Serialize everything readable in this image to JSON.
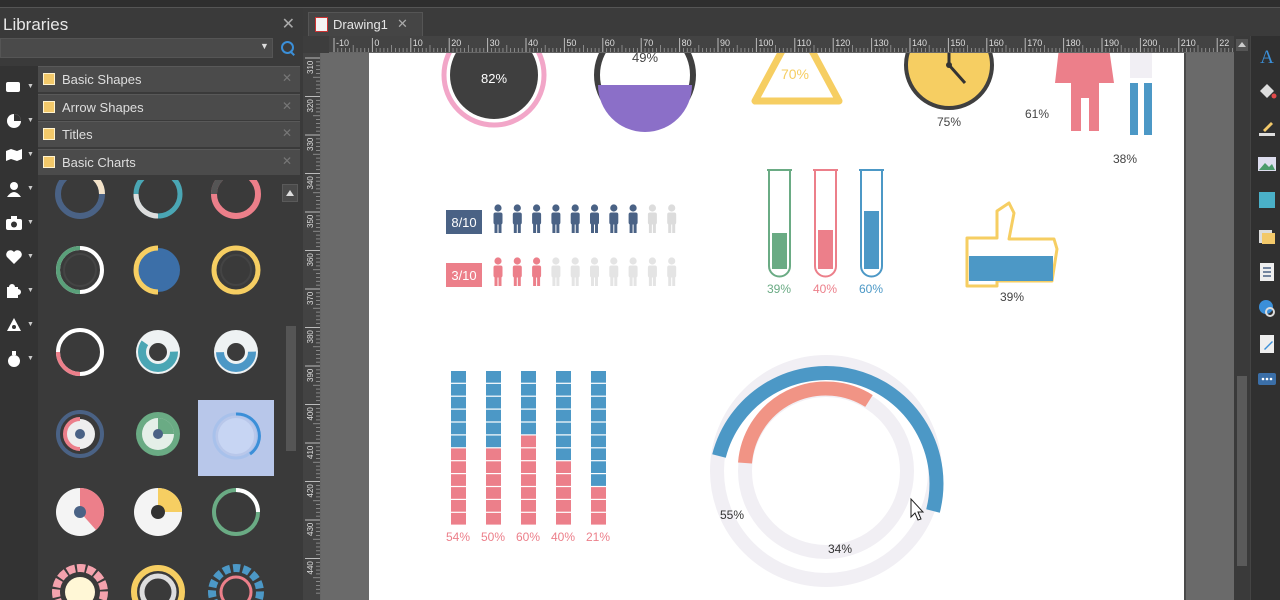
{
  "libraries": {
    "title": "Libraries",
    "search_placeholder": "",
    "categories": [
      {
        "icon": "rectangle-shape-icon"
      },
      {
        "icon": "pie-chart-icon"
      },
      {
        "icon": "map-icon"
      },
      {
        "icon": "people-icon"
      },
      {
        "icon": "camera-icon"
      },
      {
        "icon": "heart-icon"
      },
      {
        "icon": "puzzle-icon"
      },
      {
        "icon": "network-icon"
      },
      {
        "icon": "bottle-icon"
      }
    ],
    "items": [
      {
        "label": "Basic Shapes"
      },
      {
        "label": "Arrow Shapes"
      },
      {
        "label": "Titles"
      },
      {
        "label": "Basic Charts"
      }
    ]
  },
  "tab": {
    "label": "Drawing1"
  },
  "ruler": {
    "h_labels": [
      "-10",
      "0",
      "10",
      "20",
      "30",
      "40",
      "50",
      "60",
      "70",
      "80",
      "90",
      "100",
      "110",
      "120",
      "130",
      "140",
      "150",
      "160",
      "170",
      "180",
      "190",
      "200",
      "210",
      "22"
    ],
    "v_labels": [
      "310",
      "320",
      "330",
      "340",
      "350",
      "360",
      "370",
      "380",
      "390",
      "400",
      "410",
      "420",
      "430",
      "440"
    ]
  },
  "infographic": {
    "top_circle_pct": "82%",
    "top_bowl_pct": "49%",
    "top_triangle_pct": "70%",
    "top_clock_pct": "75%",
    "woman_pct": "61%",
    "man_pct": "38%",
    "people_blue_label": "8/10",
    "people_pink_label": "3/10",
    "tube_values": [
      "39%",
      "40%",
      "60%"
    ],
    "thumb_pct": "39%",
    "bar_labels": [
      "54%",
      "50%",
      "60%",
      "40%",
      "21%"
    ],
    "donut_outer_pct": "55%",
    "donut_inner_pct": "34%"
  },
  "colors": {
    "blue": "#4c98c6",
    "navy": "#4a6285",
    "pink": "#ec7f8a",
    "green": "#6aab84",
    "yellow": "#f6ce62",
    "purple": "#8b6fc8",
    "salmon": "#f19485",
    "gray_ring": "#f1eff4"
  }
}
